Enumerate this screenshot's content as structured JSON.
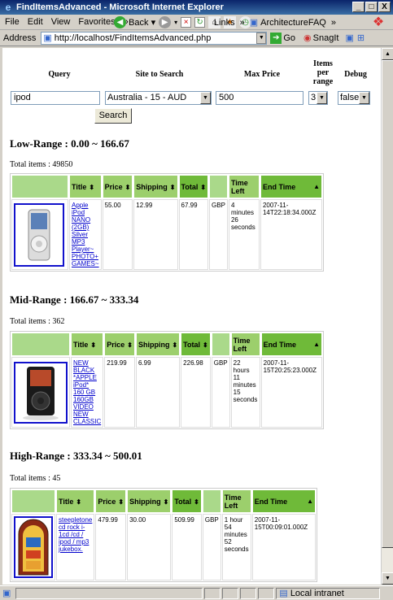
{
  "window": {
    "title": "FindItemsAdvanced - Microsoft Internet Explorer",
    "buttons": [
      "_",
      "□",
      "X"
    ]
  },
  "menu": [
    "File",
    "Edit",
    "View",
    "Favorites"
  ],
  "toolbar": {
    "back_label": "Back",
    "links": "Links",
    "architecture": "ArchitectureFAQ",
    "chevrons": "»"
  },
  "address": {
    "label": "Address",
    "url": "http://localhost/FindItemsAdvanced.php",
    "go": "Go",
    "snagit": "SnagIt"
  },
  "status": {
    "zone": "Local intranet"
  },
  "form": {
    "query_header": "Query",
    "site_header": "Site to Search",
    "price_header": "Max Price",
    "items_header": "Items per range",
    "debug_header": "Debug",
    "query_value": "ipod",
    "site_value": "Australia - 15 - AUD",
    "price_value": "500",
    "items_value": "3",
    "debug_value": "false",
    "search_label": "Search"
  },
  "columns": {
    "title": "Title",
    "price": "Price",
    "shipping": "Shipping",
    "total": "Total",
    "time_left": "Time Left",
    "end_time": "End Time"
  },
  "ranges": [
    {
      "heading": "Low-Range : 0.00 ~ 166.67",
      "total": "Total items : 49850",
      "item": {
        "title": "Apple iPod NANO (2GB) Silver MP3 Player~ PHOTO+ GAMES~",
        "price": "55.00",
        "shipping": "12.99",
        "total": "67.99",
        "currency": "GBP",
        "time_left": "4 minutes 26 seconds",
        "end_time": "2007-11-14T22:18:34.000Z",
        "image": "ipod-nano-silver"
      }
    },
    {
      "heading": "Mid-Range : 166.67 ~ 333.34",
      "total": "Total items : 362",
      "item": {
        "title": "NEW BLACK *APPLE iPod* 160 GB 160GB VIDEO NEW CLASSIC",
        "price": "219.99",
        "shipping": "6.99",
        "total": "226.98",
        "currency": "GBP",
        "time_left": "22 hours 11 minutes 15 seconds",
        "end_time": "2007-11-15T20:25:23.000Z",
        "image": "ipod-classic-black"
      }
    },
    {
      "heading": "High-Range : 333.34 ~ 500.01",
      "total": "Total items : 45",
      "item": {
        "title": "steepletone cd rock i-1cd /cd / ipod / mp3 jukebox.",
        "price": "479.99",
        "shipping": "30.00",
        "total": "509.99",
        "currency": "GBP",
        "time_left": "1 hour 54 minutes 52 seconds",
        "end_time": "2007-11-15T00:09:01.000Z",
        "image": "jukebox"
      }
    }
  ]
}
